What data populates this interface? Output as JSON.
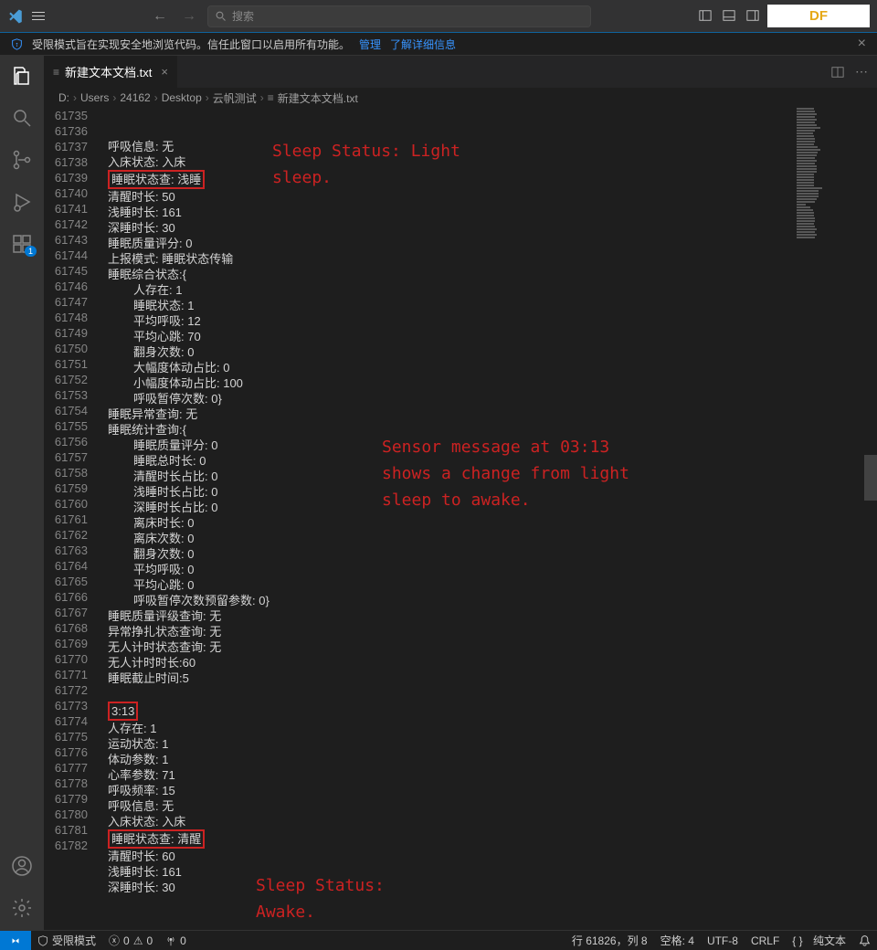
{
  "titlebar": {
    "search_placeholder": "搜索",
    "badge": "DF"
  },
  "trust": {
    "message": "受限模式旨在实现安全地浏览代码。信任此窗口以启用所有功能。",
    "manage": "管理",
    "learn_more": "了解详细信息"
  },
  "tab": {
    "filename": "新建文本文档.txt"
  },
  "breadcrumbs": {
    "parts": [
      "D:",
      "Users",
      "24162",
      "Desktop",
      "云帆测试",
      "新建文本文档.txt"
    ]
  },
  "annotations": {
    "a1": "Sleep Status: Light\nsleep.",
    "a2": "Sensor message at 03:13\nshows a change from light\nsleep to awake.",
    "a3": "Sleep Status:\nAwake."
  },
  "lines": [
    {
      "n": "61735",
      "t": "呼吸信息: 无"
    },
    {
      "n": "61736",
      "t": "入床状态: 入床"
    },
    {
      "n": "61737",
      "t": "睡眠状态查: 浅睡",
      "box": true
    },
    {
      "n": "61738",
      "t": "清醒时长: 50"
    },
    {
      "n": "61739",
      "t": "浅睡时长: 161"
    },
    {
      "n": "61740",
      "t": "深睡时长: 30"
    },
    {
      "n": "61741",
      "t": "睡眠质量评分: 0"
    },
    {
      "n": "61742",
      "t": "上报模式: 睡眠状态传输"
    },
    {
      "n": "61743",
      "t": "睡眠综合状态:{"
    },
    {
      "n": "61744",
      "t": "人存在: 1",
      "i": 1
    },
    {
      "n": "61745",
      "t": "睡眠状态: 1",
      "i": 1
    },
    {
      "n": "61746",
      "t": "平均呼吸: 12",
      "i": 1
    },
    {
      "n": "61747",
      "t": "平均心跳: 70",
      "i": 1
    },
    {
      "n": "61748",
      "t": "翻身次数: 0",
      "i": 1
    },
    {
      "n": "61749",
      "t": "大幅度体动占比: 0",
      "i": 1
    },
    {
      "n": "61750",
      "t": "小幅度体动占比: 100",
      "i": 1
    },
    {
      "n": "61751",
      "t": "呼吸暂停次数: 0}",
      "i": 1
    },
    {
      "n": "61752",
      "t": "睡眠异常查询: 无"
    },
    {
      "n": "61753",
      "t": "睡眠统计查询:{"
    },
    {
      "n": "61754",
      "t": "睡眠质量评分: 0",
      "i": 1
    },
    {
      "n": "61755",
      "t": "睡眠总时长: 0",
      "i": 1
    },
    {
      "n": "61756",
      "t": "清醒时长占比: 0",
      "i": 1
    },
    {
      "n": "61757",
      "t": "浅睡时长占比: 0",
      "i": 1
    },
    {
      "n": "61758",
      "t": "深睡时长占比: 0",
      "i": 1
    },
    {
      "n": "61759",
      "t": "离床时长: 0",
      "i": 1
    },
    {
      "n": "61760",
      "t": "离床次数: 0",
      "i": 1
    },
    {
      "n": "61761",
      "t": "翻身次数: 0",
      "i": 1
    },
    {
      "n": "61762",
      "t": "平均呼吸: 0",
      "i": 1
    },
    {
      "n": "61763",
      "t": "平均心跳: 0",
      "i": 1
    },
    {
      "n": "61764",
      "t": "呼吸暂停次数预留参数: 0}",
      "i": 1
    },
    {
      "n": "61765",
      "t": "睡眠质量评级查询: 无"
    },
    {
      "n": "61766",
      "t": "异常挣扎状态查询: 无"
    },
    {
      "n": "61767",
      "t": "无人计时状态查询: 无"
    },
    {
      "n": "61768",
      "t": "无人计时时长:60"
    },
    {
      "n": "61769",
      "t": "睡眠截止时间:5"
    },
    {
      "n": "61770",
      "t": ""
    },
    {
      "n": "61771",
      "t": "3:13",
      "box": true
    },
    {
      "n": "61772",
      "t": "人存在: 1"
    },
    {
      "n": "61773",
      "t": "运动状态: 1"
    },
    {
      "n": "61774",
      "t": "体动参数: 1"
    },
    {
      "n": "61775",
      "t": "心率参数: 71"
    },
    {
      "n": "61776",
      "t": "呼吸频率: 15"
    },
    {
      "n": "61777",
      "t": "呼吸信息: 无"
    },
    {
      "n": "61778",
      "t": "入床状态: 入床"
    },
    {
      "n": "61779",
      "t": "睡眠状态查: 清醒",
      "box": true
    },
    {
      "n": "61780",
      "t": "清醒时长: 60"
    },
    {
      "n": "61781",
      "t": "浅睡时长: 161"
    },
    {
      "n": "61782",
      "t": "深睡时长: 30"
    }
  ],
  "statusbar": {
    "restricted": "受限模式",
    "errors": "0",
    "warnings": "0",
    "port": "0",
    "ln_col": "行 61826，列 8",
    "spaces": "空格: 4",
    "encoding": "UTF-8",
    "eol": "CRLF",
    "lang": "纯文本"
  }
}
